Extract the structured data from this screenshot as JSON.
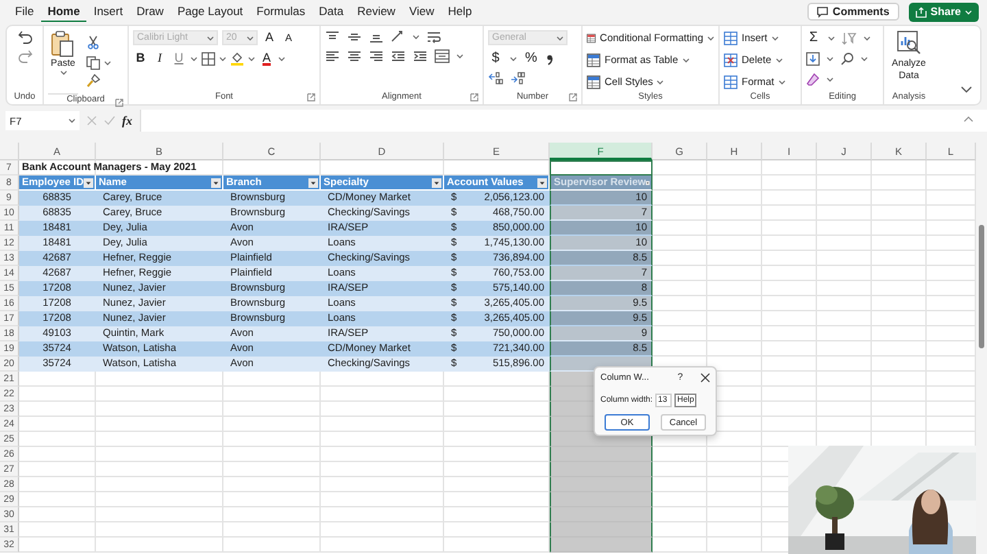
{
  "menu_tabs": [
    {
      "label": "File",
      "selected": false
    },
    {
      "label": "Home",
      "selected": true
    },
    {
      "label": "Insert",
      "selected": false
    },
    {
      "label": "Draw",
      "selected": false
    },
    {
      "label": "Page Layout",
      "selected": false
    },
    {
      "label": "Formulas",
      "selected": false
    },
    {
      "label": "Data",
      "selected": false
    },
    {
      "label": "Review",
      "selected": false
    },
    {
      "label": "View",
      "selected": false
    },
    {
      "label": "Help",
      "selected": false
    }
  ],
  "comments_button": {
    "label": "Comments"
  },
  "share_button": {
    "label": "Share"
  },
  "ribbon": {
    "undo": {
      "label": "Undo"
    },
    "clipboard": {
      "label": "Clipboard",
      "paste": "Paste"
    },
    "font": {
      "label": "Font",
      "font_name": {
        "value": "Calibri Light",
        "disabled": true
      },
      "font_size": {
        "value": "20",
        "disabled": true
      },
      "size_buttons": [
        "A",
        "A"
      ],
      "style_buttons": [
        "B",
        "I",
        "U"
      ],
      "font_color": "A"
    },
    "alignment": {
      "label": "Alignment"
    },
    "number": {
      "label": "Number",
      "format": {
        "value": "General",
        "disabled": true
      },
      "buttons": [
        "$",
        "%"
      ]
    },
    "styles": {
      "label": "Styles",
      "items": [
        "Conditional Formatting",
        "Format as Table",
        "Cell Styles"
      ]
    },
    "cells": {
      "label": "Cells",
      "items": [
        "Insert",
        "Delete",
        "Format"
      ]
    },
    "editing": {
      "label": "Editing",
      "sum": "Σ"
    },
    "analysis": {
      "label": "Analysis",
      "button": "Analyze Data"
    }
  },
  "formula_bar": {
    "name_box": "F7",
    "insert_function": "fx"
  },
  "sheet": {
    "columns": [
      {
        "label": "A",
        "selected": false
      },
      {
        "label": "B",
        "selected": false
      },
      {
        "label": "C",
        "selected": false
      },
      {
        "label": "D",
        "selected": false
      },
      {
        "label": "E",
        "selected": false
      },
      {
        "label": "F",
        "selected": true
      },
      {
        "label": "G",
        "selected": false
      },
      {
        "label": "H",
        "selected": false
      },
      {
        "label": "I",
        "selected": false
      },
      {
        "label": "J",
        "selected": false
      },
      {
        "label": "K",
        "selected": false
      },
      {
        "label": "L",
        "selected": false
      }
    ],
    "row_numbers": [
      "7",
      "8",
      "9",
      "10",
      "11",
      "12",
      "13",
      "14",
      "15",
      "16",
      "17",
      "18",
      "19",
      "20",
      "21",
      "22",
      "23",
      "24",
      "25",
      "26",
      "27",
      "28",
      "29",
      "30",
      "31",
      "32"
    ],
    "title": "Bank Account Managers - May 2021",
    "headers": [
      "Employee ID",
      "Name",
      "Branch",
      "Specialty",
      "Account Values",
      "Supervisor Review"
    ],
    "rows": [
      {
        "employee_id": "68835",
        "name": "Carey, Bruce",
        "branch": "Brownsburg",
        "specialty": "CD/Money Market",
        "currency": "$",
        "account_value": "2,056,123.00",
        "review": "10"
      },
      {
        "employee_id": "68835",
        "name": "Carey, Bruce",
        "branch": "Brownsburg",
        "specialty": "Checking/Savings",
        "currency": "$",
        "account_value": "468,750.00",
        "review": "7"
      },
      {
        "employee_id": "18481",
        "name": "Dey, Julia",
        "branch": "Avon",
        "specialty": "IRA/SEP",
        "currency": "$",
        "account_value": "850,000.00",
        "review": "10"
      },
      {
        "employee_id": "18481",
        "name": "Dey, Julia",
        "branch": "Avon",
        "specialty": "Loans",
        "currency": "$",
        "account_value": "1,745,130.00",
        "review": "10"
      },
      {
        "employee_id": "42687",
        "name": "Hefner, Reggie",
        "branch": "Plainfield",
        "specialty": "Checking/Savings",
        "currency": "$",
        "account_value": "736,894.00",
        "review": "8.5"
      },
      {
        "employee_id": "42687",
        "name": "Hefner, Reggie",
        "branch": "Plainfield",
        "specialty": "Loans",
        "currency": "$",
        "account_value": "760,753.00",
        "review": "7"
      },
      {
        "employee_id": "17208",
        "name": "Nunez, Javier",
        "branch": "Brownsburg",
        "specialty": "IRA/SEP",
        "currency": "$",
        "account_value": "575,140.00",
        "review": "8"
      },
      {
        "employee_id": "17208",
        "name": "Nunez, Javier",
        "branch": "Brownsburg",
        "specialty": "Loans",
        "currency": "$",
        "account_value": "3,265,405.00",
        "review": "9.5"
      },
      {
        "employee_id": "17208",
        "name": "Nunez, Javier",
        "branch": "Brownsburg",
        "specialty": "Loans",
        "currency": "$",
        "account_value": "3,265,405.00",
        "review": "9.5"
      },
      {
        "employee_id": "49103",
        "name": "Quintin, Mark",
        "branch": "Avon",
        "specialty": "IRA/SEP",
        "currency": "$",
        "account_value": "750,000.00",
        "review": "9"
      },
      {
        "employee_id": "35724",
        "name": "Watson, Latisha",
        "branch": "Avon",
        "specialty": "CD/Money Market",
        "currency": "$",
        "account_value": "721,340.00",
        "review": "8.5"
      },
      {
        "employee_id": "35724",
        "name": "Watson, Latisha",
        "branch": "Avon",
        "specialty": "Checking/Savings",
        "currency": "$",
        "account_value": "515,896.00"
      }
    ]
  },
  "dialog": {
    "title": "Column W...",
    "help_button": "?",
    "field_label": "Column width:",
    "value": "13",
    "tooltip": "Help",
    "buttons": [
      "OK",
      "Cancel"
    ]
  }
}
